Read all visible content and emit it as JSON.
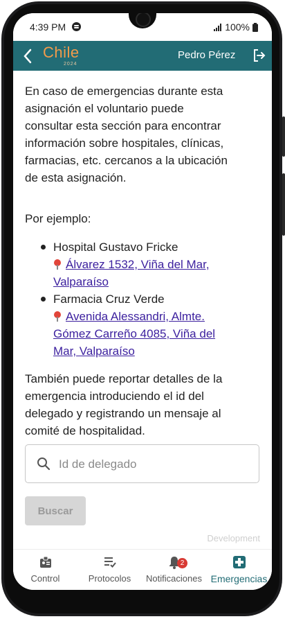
{
  "status_bar": {
    "time": "4:39 PM",
    "battery": "100%"
  },
  "app_bar": {
    "logo_text": "Chile",
    "logo_year": "2024",
    "user_name": "Pedro Pérez"
  },
  "content": {
    "intro_lines": [
      "En caso de emergencias durante esta",
      "asignación el voluntario puede",
      "consultar esta sección para encontrar",
      "información sobre hospitales, clínicas,",
      "farmacias, etc. cercanos a la ubicación",
      "de esta asignación."
    ],
    "example_label": "Por ejemplo:",
    "places": [
      {
        "name": "Hospital Gustavo Fricke",
        "address_lines": [
          "Álvarez 1532, Viña del Mar,",
          "Valparaíso"
        ]
      },
      {
        "name": "Farmacia Cruz Verde",
        "address_lines": [
          "Avenida Alessandri, Almte.",
          "Gómez Carreño 4085, Viña del",
          "Mar, Valparaíso"
        ]
      }
    ],
    "report_lines": [
      "También puede reportar detalles de la",
      "emergencia introduciendo el id del",
      "delegado y registrando un mensaje al",
      "comité de hospitalidad."
    ],
    "search": {
      "placeholder": "Id de delegado",
      "value": ""
    },
    "search_button": "Buscar",
    "environment": "Development"
  },
  "bottom_nav": {
    "items": [
      {
        "label": "Control",
        "icon": "badge-icon"
      },
      {
        "label": "Protocolos",
        "icon": "checklist-icon"
      },
      {
        "label": "Notificaciones",
        "icon": "bell-icon",
        "badge": "2"
      },
      {
        "label": "Emergencias",
        "icon": "medical-cross-icon",
        "active": true
      }
    ]
  },
  "colors": {
    "primary": "#226c75",
    "accent": "#f29b4a",
    "link": "#3b1f9e",
    "badge": "#d83a34"
  }
}
